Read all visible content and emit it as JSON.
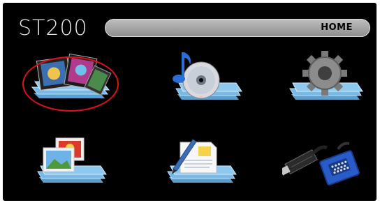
{
  "brand": "ST200",
  "header_bar": {
    "label": "HOME"
  },
  "menu": [
    {
      "name": "video-icon",
      "selected": true
    },
    {
      "name": "music-icon",
      "selected": false
    },
    {
      "name": "settings-icon",
      "selected": false
    },
    {
      "name": "photo-icon",
      "selected": false
    },
    {
      "name": "document-icon",
      "selected": false
    },
    {
      "name": "connector-icon",
      "selected": false
    }
  ],
  "colors": {
    "background": "#000000",
    "bar": "#a9a9a9",
    "folder": "#7ab9e6",
    "selection": "#e0101a"
  }
}
